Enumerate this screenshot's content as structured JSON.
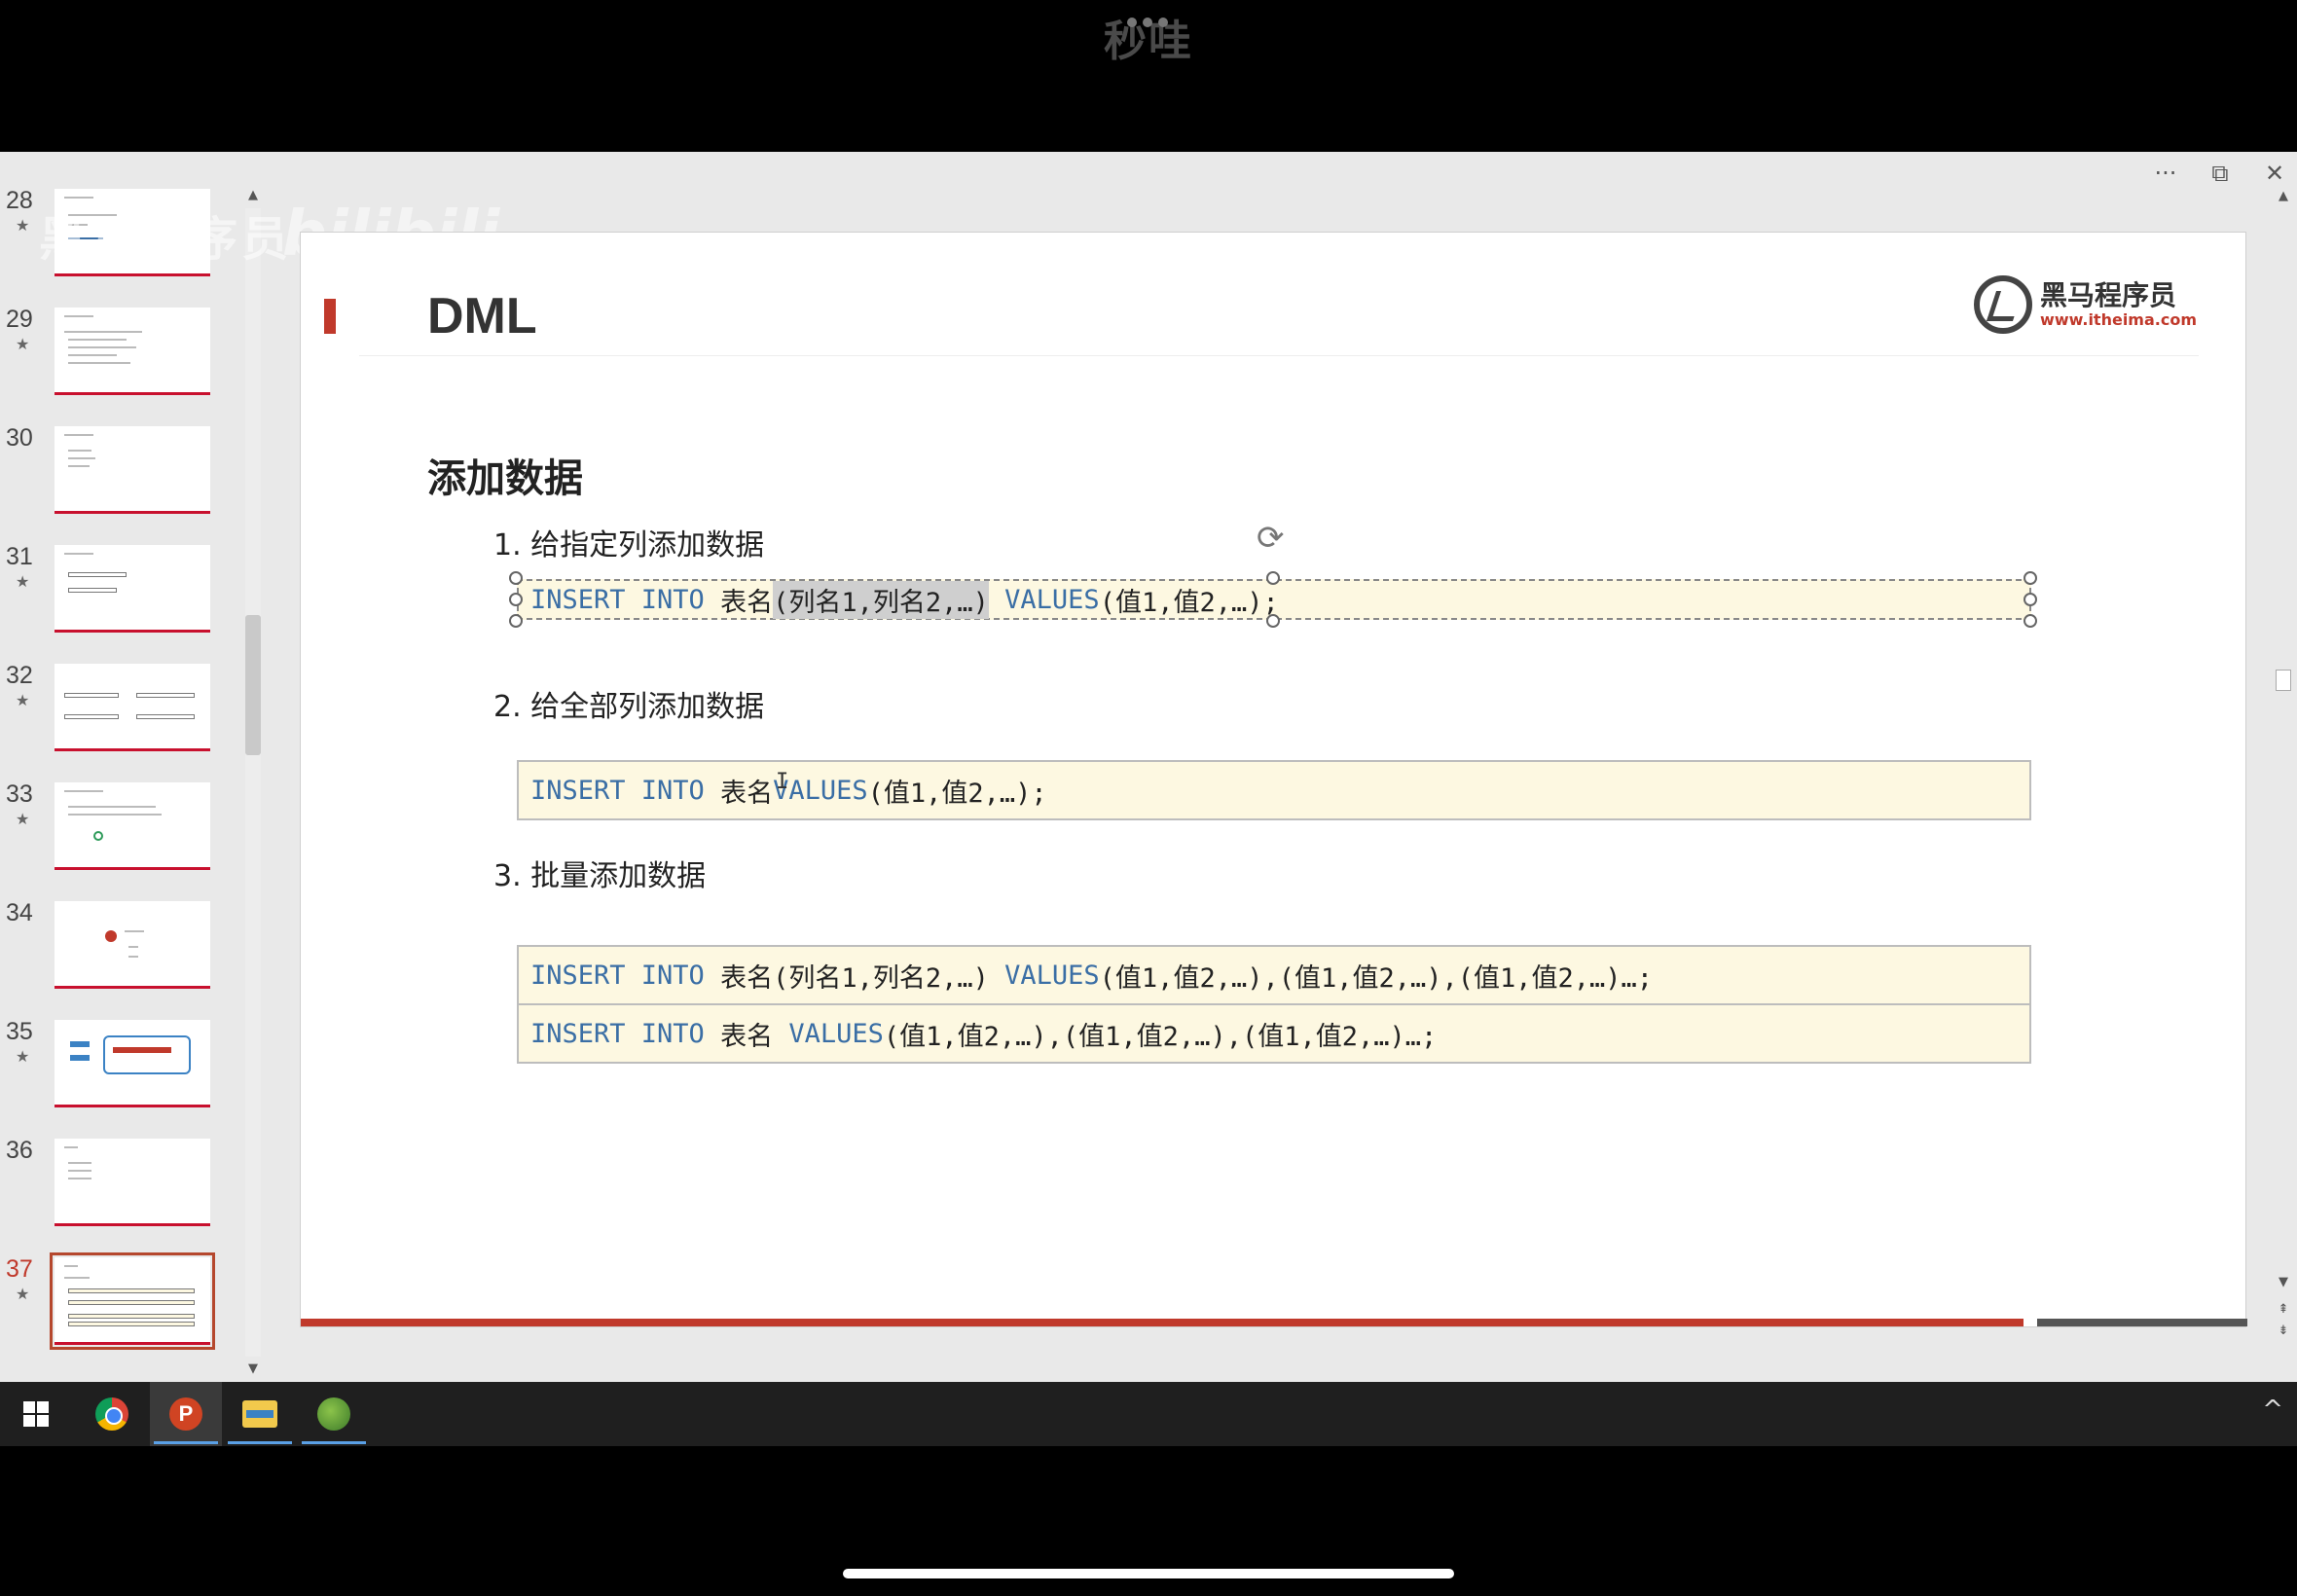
{
  "device": {
    "top_title": "秒哇"
  },
  "window_controls": {
    "more": "···",
    "restore": "⧉",
    "close": "✕"
  },
  "thumbnails": [
    {
      "number": "28",
      "star": "★"
    },
    {
      "number": "29",
      "star": "★"
    },
    {
      "number": "30",
      "star": ""
    },
    {
      "number": "31",
      "star": "★"
    },
    {
      "number": "32",
      "star": "★"
    },
    {
      "number": "33",
      "star": "★"
    },
    {
      "number": "34",
      "star": ""
    },
    {
      "number": "35",
      "star": "★"
    },
    {
      "number": "36",
      "star": ""
    },
    {
      "number": "37",
      "star": "★"
    }
  ],
  "active_slide": "37",
  "watermark": {
    "text": "黑马程序员",
    "site": "bilibili"
  },
  "slide": {
    "title": "DML",
    "logo_cn": "黑马程序员",
    "logo_url": "www.itheima.com",
    "section_title": "添加数据",
    "items": [
      {
        "label": "1. 给指定列添加数据"
      },
      {
        "label": "2. 给全部列添加数据"
      },
      {
        "label": "3. 批量添加数据"
      }
    ],
    "code1": {
      "kw1": "INSERT INTO",
      "table": " 表名",
      "cols": "(列名1,列名2,…)",
      "kw2": "VALUES",
      "vals": "(值1,值2,…);"
    },
    "code2": {
      "kw1": "INSERT INTO",
      "table": " 表名",
      "kw2": "VALUES",
      "vals": "(值1,值2,…);"
    },
    "code3": {
      "kw1": "INSERT INTO",
      "table": " 表名(列名1,列名2,…) ",
      "kw2": "VALUES",
      "vals": "(值1,值2,…),(值1,值2,…),(值1,值2,…)…;"
    },
    "code4": {
      "kw1": "INSERT INTO",
      "table": " 表名 ",
      "kw2": "VALUES",
      "vals": "(值1,值2,…),(值1,值2,…),(值1,值2,…)…;"
    }
  },
  "taskbar": {
    "apps": [
      "windows-start",
      "chrome",
      "powerpoint",
      "file-explorer",
      "app"
    ],
    "ppt_letter": "P",
    "chevron": "^"
  }
}
